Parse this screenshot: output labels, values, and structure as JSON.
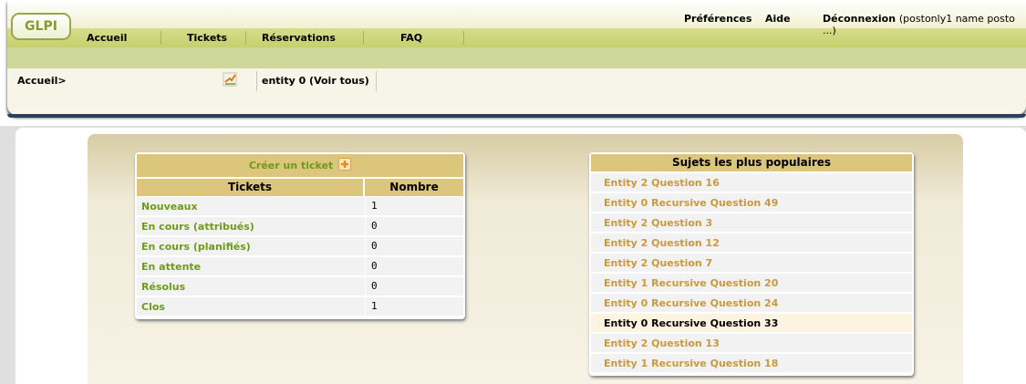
{
  "header": {
    "logo_text": "GLPI",
    "top_links": {
      "preferences": "Préférences",
      "help": "Aide",
      "logout": "Déconnexion",
      "logout_user": "(postonly1 name posto ...)"
    },
    "menu": [
      "Accueil",
      "Tickets",
      "Réservations",
      "FAQ"
    ],
    "breadcrumb": "Accueil>",
    "entity": "entity 0 (Voir tous)"
  },
  "tickets": {
    "create_label": "Créer un ticket",
    "col_status": "Tickets",
    "col_count": "Nombre",
    "rows": [
      {
        "label": "Nouveaux",
        "count": "1"
      },
      {
        "label": "En cours (attribués)",
        "count": "0"
      },
      {
        "label": "En cours (planifiés)",
        "count": "0"
      },
      {
        "label": "En attente",
        "count": "0"
      },
      {
        "label": "Résolus",
        "count": "0"
      },
      {
        "label": "Clos",
        "count": "1"
      }
    ]
  },
  "faq": {
    "title": "Sujets les plus populaires",
    "items": [
      "Entity 2 Question 16",
      "Entity 0 Recursive Question 49",
      "Entity 2 Question 3",
      "Entity 2 Question 12",
      "Entity 2 Question 7",
      "Entity 1 Recursive Question 20",
      "Entity 0 Recursive Question 24",
      "Entity 0 Recursive Question 33",
      "Entity 2 Question 13",
      "Entity 1 Recursive Question 18"
    ],
    "hovered_index": 7
  },
  "colors": {
    "accent_green": "#6f9a1a",
    "faq_link": "#c99a3c",
    "table_header": "#dcc57c",
    "menu_bar": "#c6d06c"
  }
}
